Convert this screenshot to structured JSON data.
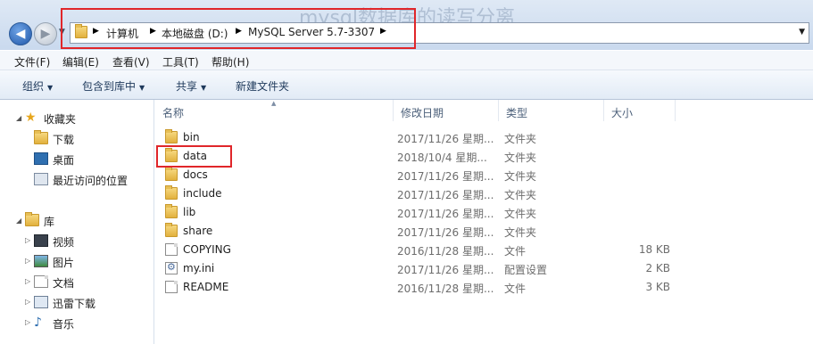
{
  "background_title": "mysql数据库的读写分离",
  "address": {
    "crumbs": [
      "计算机",
      "本地磁盘 (D:)",
      "MySQL Server 5.7-3307"
    ]
  },
  "menu": [
    "文件(F)",
    "编辑(E)",
    "查看(V)",
    "工具(T)",
    "帮助(H)"
  ],
  "toolbar": {
    "organize": "组织",
    "include_in_library": "包含到库中",
    "share": "共享",
    "new_folder": "新建文件夹"
  },
  "nav": {
    "favorites": "收藏夹",
    "downloads": "下载",
    "desktop": "桌面",
    "recent": "最近访问的位置",
    "libraries": "库",
    "videos": "视频",
    "pictures": "图片",
    "documents": "文档",
    "thunder": "迅雷下载",
    "music": "音乐"
  },
  "columns": {
    "name": "名称",
    "date": "修改日期",
    "type": "类型",
    "size": "大小"
  },
  "files": [
    {
      "name": "bin",
      "date": "2017/11/26 星期...",
      "type": "文件夹",
      "size": "",
      "icon": "folder-icon"
    },
    {
      "name": "data",
      "date": "2018/10/4 星期...",
      "type": "文件夹",
      "size": "",
      "icon": "folder-icon"
    },
    {
      "name": "docs",
      "date": "2017/11/26 星期...",
      "type": "文件夹",
      "size": "",
      "icon": "folder-icon"
    },
    {
      "name": "include",
      "date": "2017/11/26 星期...",
      "type": "文件夹",
      "size": "",
      "icon": "folder-icon"
    },
    {
      "name": "lib",
      "date": "2017/11/26 星期...",
      "type": "文件夹",
      "size": "",
      "icon": "folder-icon"
    },
    {
      "name": "share",
      "date": "2017/11/26 星期...",
      "type": "文件夹",
      "size": "",
      "icon": "folder-icon"
    },
    {
      "name": "COPYING",
      "date": "2016/11/28 星期...",
      "type": "文件",
      "size": "18 KB",
      "icon": "file-icon"
    },
    {
      "name": "my.ini",
      "date": "2017/11/26 星期...",
      "type": "配置设置",
      "size": "2 KB",
      "icon": "settings-file-icon"
    },
    {
      "name": "README",
      "date": "2016/11/28 星期...",
      "type": "文件",
      "size": "3 KB",
      "icon": "file-icon"
    }
  ],
  "colors": {
    "highlight": "#e0262a",
    "folder": "#e2b13e"
  }
}
